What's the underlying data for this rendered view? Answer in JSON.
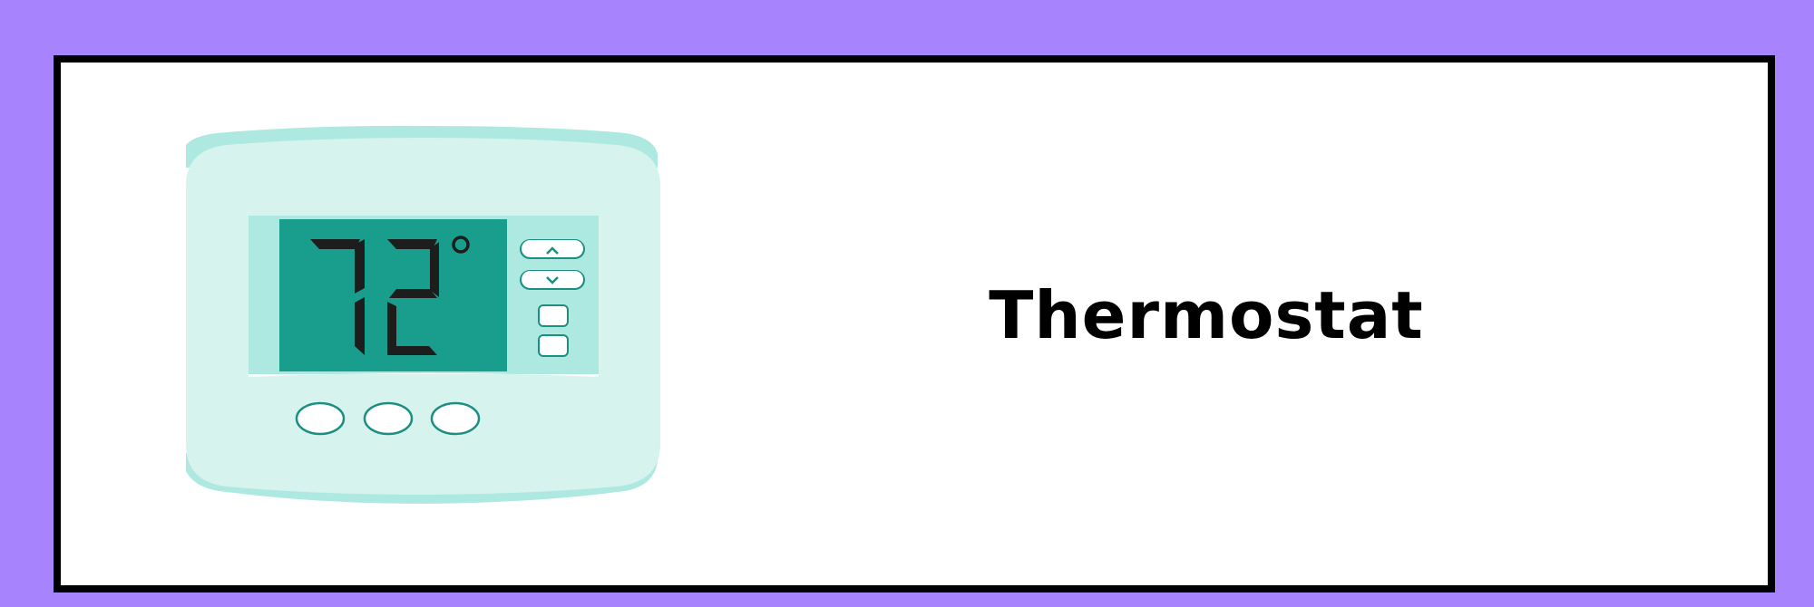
{
  "title": "Thermostat",
  "display": {
    "reading": "72",
    "unit_symbol": "°"
  },
  "icons": {
    "up": "chevron-up-icon",
    "down": "chevron-down-icon"
  },
  "colors": {
    "background": "#a784fd",
    "card": "#ffffff",
    "frame": "#000000",
    "body": "#d7f3ee",
    "body_accent": "#aee9e1",
    "screen": "#199e8d",
    "segment": "#1d1d1d",
    "button_outline": "#1b8f81"
  }
}
